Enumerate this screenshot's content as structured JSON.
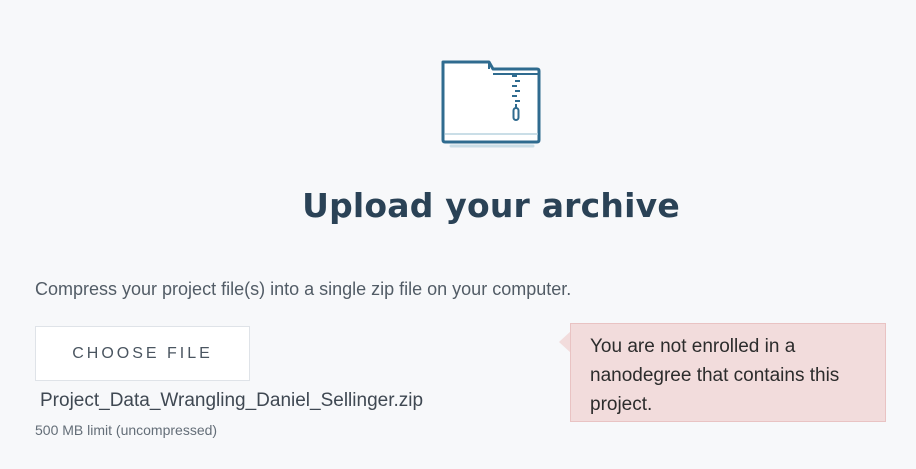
{
  "header": {
    "icon": "zip-folder-icon",
    "title": "Upload your archive"
  },
  "upload": {
    "instructions": "Compress your project file(s) into a single zip file on your computer.",
    "choose_file_label": "CHOOSE FILE",
    "selected_file": "Project_Data_Wrangling_Daniel_Sellinger.zip",
    "limit_text": "500 MB limit (uncompressed)"
  },
  "alert": {
    "message": "You are not enrolled in a nanodegree that contains this project."
  },
  "colors": {
    "background": "#f7f8fa",
    "title": "#2a4256",
    "icon_stroke": "#2f6b8f",
    "alert_background": "#f2dcdc",
    "alert_border": "#e9c3c3"
  }
}
